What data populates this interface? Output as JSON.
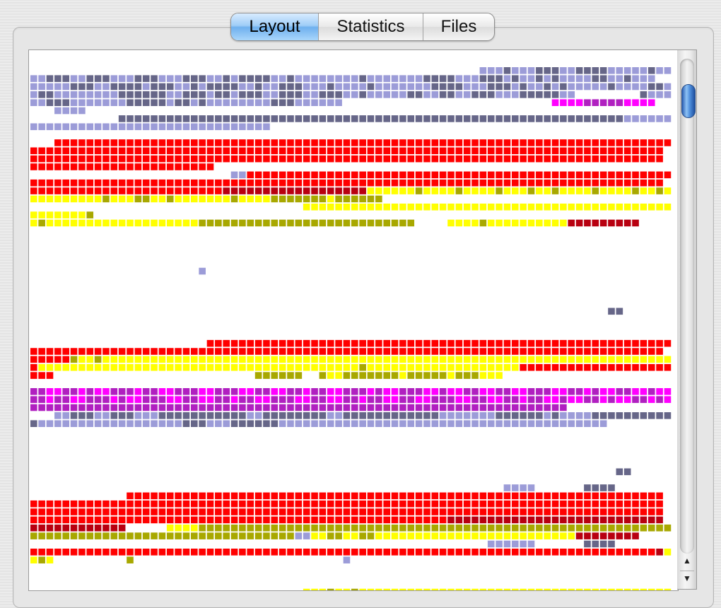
{
  "tabs": [
    {
      "label": "Layout",
      "active": true
    },
    {
      "label": "Statistics",
      "active": false
    },
    {
      "label": "Files",
      "active": false
    }
  ],
  "scroll_arrows": {
    "up": "▲",
    "down": "▼"
  },
  "colors": {
    "L": "#9c9cd8",
    "D": "#666688",
    "R": "#ff0000",
    "M": "#b80010",
    "Y": "#ffff00",
    "O": "#a8a800",
    "P": "#ff00ff",
    "V": "#b020c0",
    "W": "#ffffff"
  },
  "grid": [
    "........................................................LLLDLLLDDDLLDDDDLLLLLDLLLLL",
    "LLDDDLLDDDLLLDDDLLLDDDLLDLDDDDLLDLLLLLLLLDLLLLLLLDDDDLLLDDDLDLLDLDLLLLDDLLDLLL",
    "LLLLLDDDLLDDDDLDDDLLDLDDDDLLDLLDDDLLLDLLLLDLLLLLLLDDDDLLLDDDLDLLDLDLLLLLDLLLLDDLDDLL",
    "LDDLLLLLLLLDDDDDDLLDDDLDDLDDDLLDDDLLDDDLLDLLLLLDDLLDDLLDDDLLLDDDDDLL........DLLLDLDL",
    "LLDDDLLLLLLLDDDDDLDDLDLLLLLLLLDDDLLLLLL..........................PPPPVVVVVPPPP",
    "...LLLL",
    "...........DDDDDDDDDDDDDDDDDDDDDDDDDDDDDDDDDDDDDDDDDDDDDDDDDDDDDDDDDDDDDDDLLLLLLLLLL",
    "LLLLLLLLLLLLLLLLLLLLLLLLLLLLLL",
    "",
    "...RRRRRRRRRRRRRRRRRRRRRRRRRRRRRRRRRRRRRRRRRRRRRRRRRRRRRRRRRRRRRRRRRRRRRRRRRRRRR",
    "RRRRRRRRRRRRRRRRRRRRRRRRRRRRRRRRRRRRRRRRRRRRRRRRRRRRRRRRRRRRRRRRRRRRRRRRRRRRRRR",
    "RRRRRRRRRRRRRRRRRRRRRRRRRRRRRRRRRRRRRRRRRRRRRRRRRRRRRRRRRRRRRRRRRRRRRRRRRRRRRRR",
    "RRRRRRRRRRRRRRRRRRRRRRR",
    ".........................LLRRRRRRRRRRRRRRRRRRRRRRRRRRRRRRRRRRRRRRRRRRRRRRRRRRRRRR",
    "RRRRRRRRRRRRRRRRRRRRRRRRRRRRRRRRRRRRRRRRRRRRRRRRRRRRRRRRRRRRRRRRRRRRRRRRRRRRRRR",
    "RRRRRRRRRRRRRRRRRRRRRRRRMMMMMMMMMMMMMMMMMMYYYYYYOYYYYOYYYYOYYYOYYOYYYYOYYYYOYYOY",
    "YYYYYYYYYOYYYOOYYOYYYYYYYOYYYYOOOOOOOYOOOOOO",
    "..................................YYYYYYYYYYYYYYYYYYYYYYYYYYYYYYYYYYYYYYYYYYYYYY",
    "YYYYYYYO",
    "YOYYYYYYYYYYYYYYYYYYYOOOOOOOOOOOOOOOOOOOOOOOOOOO....YYYYOYYYYYYYYYYMMMMMMMMM"
  ],
  "grid_bottom": [
    "",
    "",
    "",
    "",
    "",
    ".....................L",
    "",
    "",
    "",
    "",
    "........................................................................DD",
    "",
    "",
    "",
    "......................RRRRRRRRRRRRRRRRRRRRRRRRRRRRRRRRRRRRRRRRRRRRRRRRRRRRRRRRRR",
    "RRRRRRRRRRRRRRRRRRRRRRRRRRRRRRRRRRRRRRRRRRRRRRRRRRRRRRRRRRRRRRRRRRRRRRRRRRRRRRR",
    "RRRRROYYOYYYYYYYYYYYYYYYYYYYYYYYYYYYYYYYYYYYYYYYYYYYYYYYYYYYYYYYYYYYYYYYYYYYYYYY",
    "RYYYYYYYYYYYYYYYYYYYYYYYYYYYYYYYYYYYYYYYYOYYYYYYYYYYYYYYYYYYYRRRRRRRRRRRRRRRRRRRR",
    "RRR.........................OOOOOO..OYYOOOOOOOYOOOOOYOOOYYY",
    ".......................................................................................P",
    "VVPPVVPVPPVVVPVVPPVVVPPVVVPPVVPPVVPVVPPVVVPVPPVVVPPVPPVVPPVVPPVVVPPVVPVPPVVPPVPP",
    "VVPVVPPVVVPVPPVVVPPVVPPVVPVVPPVVVPPVVPPVVPVVPPVVPPVVVPPVVPPVVPVVPPVPPVVPVPPVVPVPP",
    "VVVVVVVVVVVVVVVVVVVVVVVVVVVVVVVVVVVVVVVVVVVVVVVVVVVVVVVVVVVVVVVVVVV",
    "...LLDDDLLDDDLLLDDDDDDDDDDDLLDDDDDDDDLLDDDDDDDDDDDDLLLLLLLDDDDDDLDLLLLDDDDDDDDDDLLLLLL",
    "DLLLLLLLLLLLLLLLLLLDDDLLLDDDDDDLLLLLLLLLLLLLLLLLLLLLLLLLLLLLLLLLLLLLLLLL",
    "",
    "",
    "",
    "",
    "",
    ".........................................................................DD",
    "",
    "...........................................................LLLL......DDDD",
    "............RRRRRRRRRRRRRRRRRRRRRRRRRRRRRRRRRRRRRRRRRRRRRRRRRRRRRRRRRRRRRRRRRRR",
    "RRRRRRRRRRRRRRRRRRRRRRRRRRRRRRRRRRRRRRRRRRRRRRRRRRRRRRRRRRRRRRRRRRRRRRRRRRRRRRR",
    "RRRRRRRRRRRRRRRRRRRRRRRRRRRRRRRRRRRRRRRRRRRRRRRRRRRRRRRRRRRRRRRRRRRRRRRRRRRRRRR",
    "RRRRRRRRRRRRRRRRRRRRRRRRRRRRRRRRRRRRRRRRRRRRRRRRRRRRMMMMMMMMMMMMMMMMMMMMMMMMMMM",
    "MMMMMMMMMMMM.....YYYYOOOOOOOOOOOOOOOOOOOOOOOOOOOOOOOOOOOOOOOOOOOOOOOOOOOOOOOOOOOOOO",
    "OOOOOOOOOOOOOOOOOOOOOOOOOOOOOOOOOLLYYOOYYOOYYYYYYYYYYYYYYYYYYYYYYYYYMMMMMMMM",
    ".........................................................LLLLLL......DDDD...............R",
    "RRRRRRRRRRRRRRRRRRRRRRRRRRRRRRRRRRRRRRRRRRRRRRRRRRRRRRRRRRRRRRRRRRRRRRRRRRRRRRMY",
    "YOY.........O..........................L",
    "",
    "",
    "",
    "..................................YYYOYYOYYYYYYYYYYYYYYYYYYYYYYYYYYYYYYYYYYYYYYYYY",
    "YYYYYYYYYYYYYRRRRRRR..............................................................LL"
  ]
}
